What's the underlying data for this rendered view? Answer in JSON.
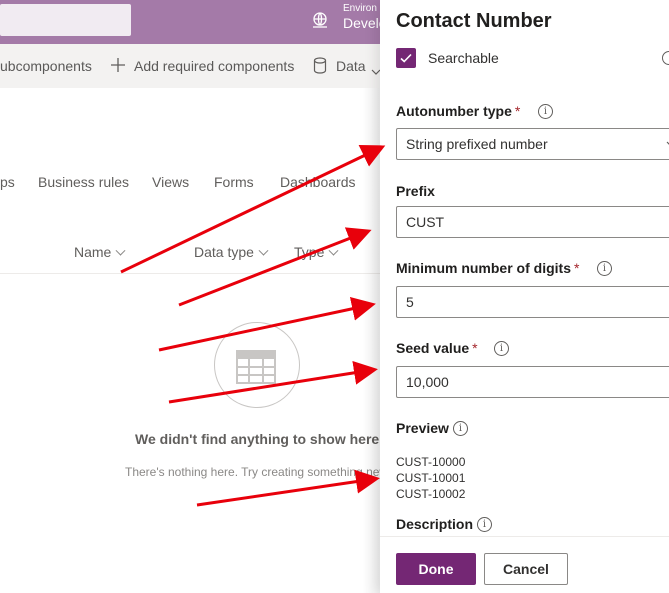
{
  "topbar": {
    "environment_label": "Environ",
    "environment_name": "Develo"
  },
  "commandbar": {
    "subcomponents_label": "ubcomponents",
    "add_required_label": "Add required components",
    "data_label": "Data"
  },
  "tabs": [
    "ps",
    "Business rules",
    "Views",
    "Forms",
    "Dashboards"
  ],
  "columns": [
    {
      "label": "Name"
    },
    {
      "label": "Data type"
    },
    {
      "label": "Type"
    }
  ],
  "empty_state": {
    "title": "We didn't find anything to show here",
    "subtitle": "There's nothing here. Try creating something new"
  },
  "panel": {
    "title": "Contact Number",
    "searchable_label": "Searchable",
    "searchable_checked": true,
    "autonumber_type": {
      "label": "Autonumber type",
      "required_mark": "*",
      "value": "String prefixed number"
    },
    "prefix": {
      "label": "Prefix",
      "value": "CUST"
    },
    "min_digits": {
      "label": "Minimum number of digits",
      "required_mark": "*",
      "value": "5"
    },
    "seed_value": {
      "label": "Seed value",
      "required_mark": "*",
      "value": "10,000"
    },
    "preview": {
      "label": "Preview",
      "lines": [
        "CUST-10000",
        "CUST-10001",
        "CUST-10002"
      ]
    },
    "description": {
      "label": "Description"
    },
    "info_glyph": "i",
    "done_label": "Done",
    "cancel_label": "Cancel"
  },
  "colors": {
    "brand": "#742774",
    "topbar": "#a47aa8",
    "annotation_arrow": "#e8000b",
    "required": "#a4262c"
  }
}
